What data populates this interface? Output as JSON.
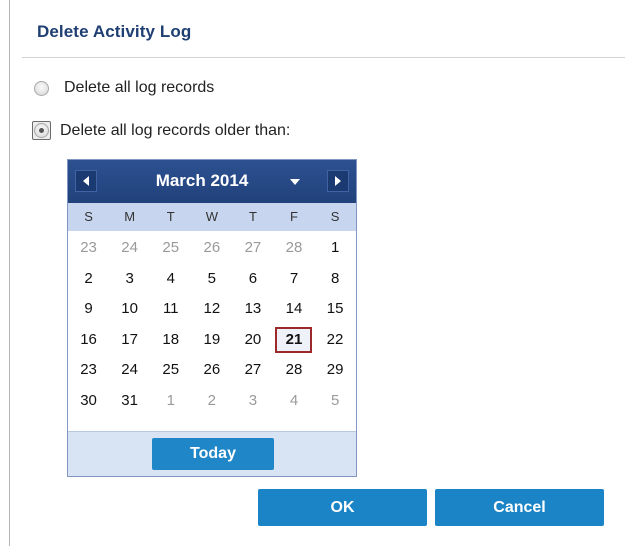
{
  "dialog": {
    "title": "Delete Activity Log",
    "options": [
      {
        "label": "Delete all log records",
        "selected": false
      },
      {
        "label": "Delete all log records older than:",
        "selected": true
      }
    ],
    "ok_label": "OK",
    "cancel_label": "Cancel"
  },
  "calendar": {
    "month_label": "March 2014",
    "weekdays": [
      "S",
      "M",
      "T",
      "W",
      "T",
      "F",
      "S"
    ],
    "weeks": [
      [
        "23",
        "24",
        "25",
        "26",
        "27",
        "28",
        "1"
      ],
      [
        "2",
        "3",
        "4",
        "5",
        "6",
        "7",
        "8"
      ],
      [
        "9",
        "10",
        "11",
        "12",
        "13",
        "14",
        "15"
      ],
      [
        "16",
        "17",
        "18",
        "19",
        "20",
        "21",
        "22"
      ],
      [
        "23",
        "24",
        "25",
        "26",
        "27",
        "28",
        "29"
      ],
      [
        "30",
        "31",
        "1",
        "2",
        "3",
        "4",
        "5"
      ]
    ],
    "other_month": [
      [
        true,
        true,
        true,
        true,
        true,
        true,
        false
      ],
      [
        false,
        false,
        false,
        false,
        false,
        false,
        false
      ],
      [
        false,
        false,
        false,
        false,
        false,
        false,
        false
      ],
      [
        false,
        false,
        false,
        false,
        false,
        false,
        false
      ],
      [
        false,
        false,
        false,
        false,
        false,
        false,
        false
      ],
      [
        false,
        false,
        true,
        true,
        true,
        true,
        true
      ]
    ],
    "selected_day": "21",
    "today_label": "Today"
  },
  "icons": {
    "prev": "triangle-left-icon",
    "next": "triangle-right-icon",
    "dropdown": "chevron-down-icon"
  },
  "colors": {
    "title_text": "#1f3f73",
    "calendar_header": "#21417a",
    "weekday_row": "#c7d6ee",
    "button": "#1a84c6",
    "selected_border": "#9c2a2a"
  }
}
